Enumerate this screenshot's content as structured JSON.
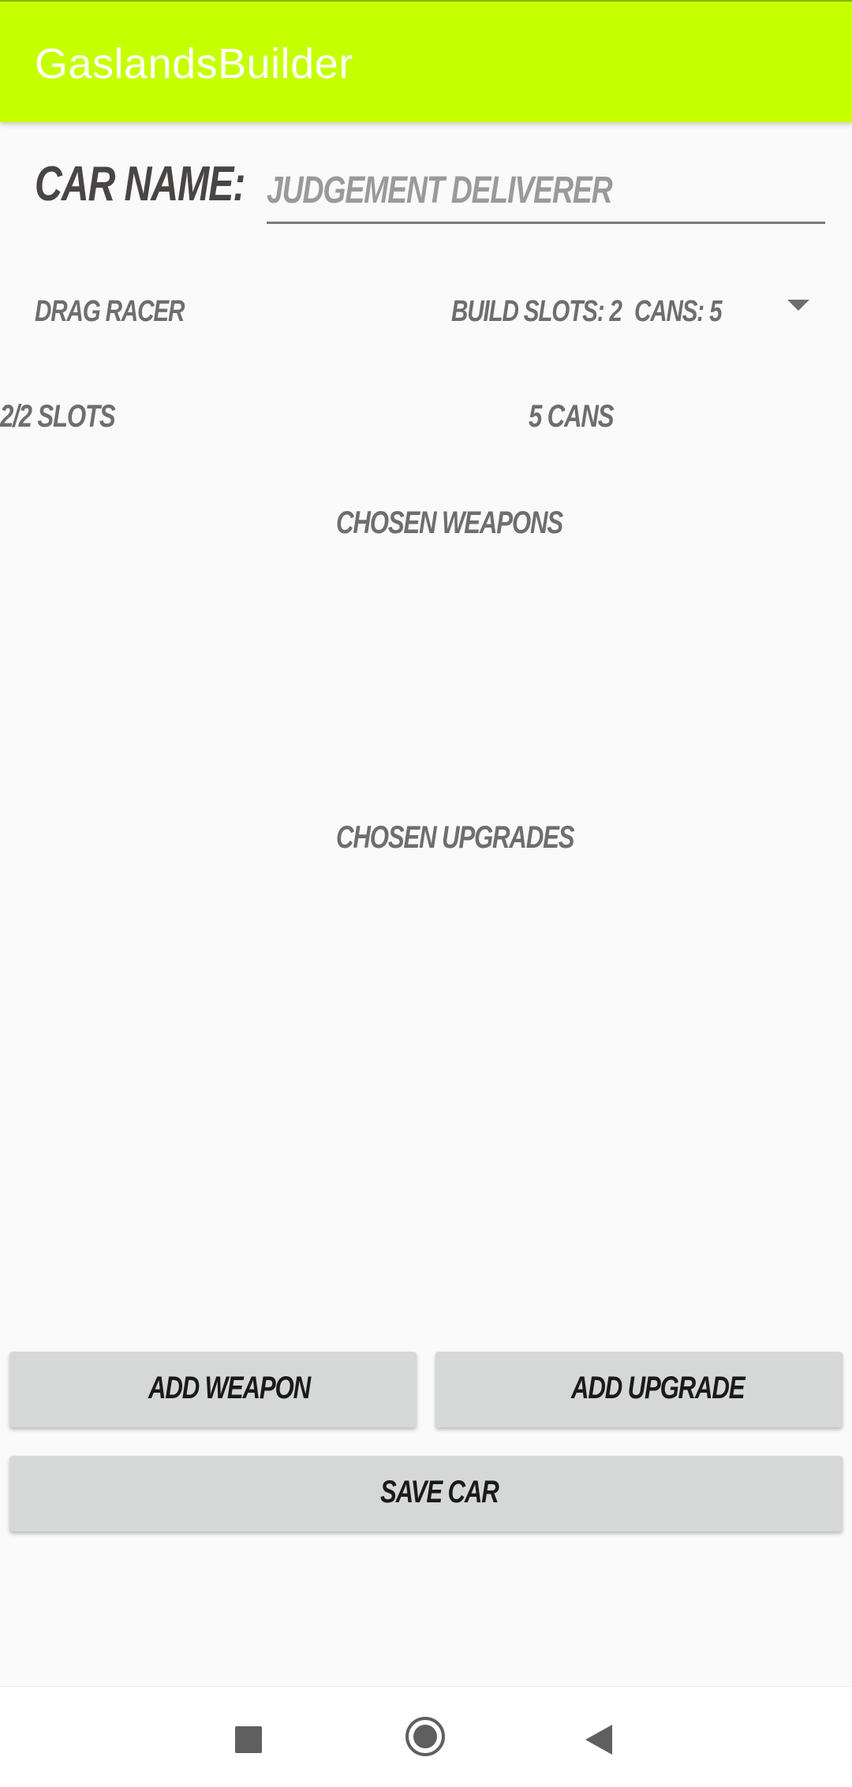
{
  "app_bar": {
    "title": "GaslandsBuilder",
    "color": "#c6ff00"
  },
  "car_name": {
    "label": "CAR NAME:",
    "value": "JUDGEMENT DELIVERER"
  },
  "vehicle_spinner": {
    "selected_type": "DRAG RACER",
    "build_slots": "BUILD SLOTS: 2",
    "cans": "CANS: 5",
    "icon": "dropdown-arrow-icon"
  },
  "summary": {
    "slots": "2/2 SLOTS",
    "cans": "5 CANS"
  },
  "sections": {
    "weapons_heading": "CHOSEN WEAPONS",
    "upgrades_heading": "CHOSEN UPGRADES"
  },
  "buttons": {
    "add_weapon": "ADD WEAPON",
    "add_upgrade": "ADD UPGRADE",
    "save_car": "SAVE CAR"
  },
  "nav_bar": {
    "icons": [
      "recents-square-icon",
      "home-circle-icon",
      "back-triangle-icon"
    ]
  }
}
